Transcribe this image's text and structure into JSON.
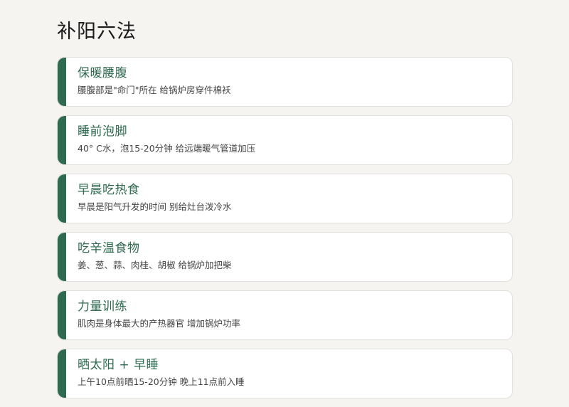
{
  "page": {
    "title": "补阳六法"
  },
  "accent_color": "#2d6a4f",
  "items": [
    {
      "title": "保暖腰腹",
      "description": "腰腹部是\"命门\"所在  给锅炉房穿件棉袄"
    },
    {
      "title": "睡前泡脚",
      "description": "40° C水，泡15-20分钟  给远端暖气管道加压"
    },
    {
      "title": "早晨吃热食",
      "description": "早晨是阳气升发的时间  别给灶台泼冷水"
    },
    {
      "title": "吃辛温食物",
      "description": "姜、葱、蒜、肉桂、胡椒  给锅炉加把柴"
    },
    {
      "title": "力量训练",
      "description": "肌肉是身体最大的产热器官  增加锅炉功率"
    },
    {
      "title": "晒太阳 + 早睡",
      "description": "上午10点前晒15-20分钟  晚上11点前入睡"
    }
  ]
}
